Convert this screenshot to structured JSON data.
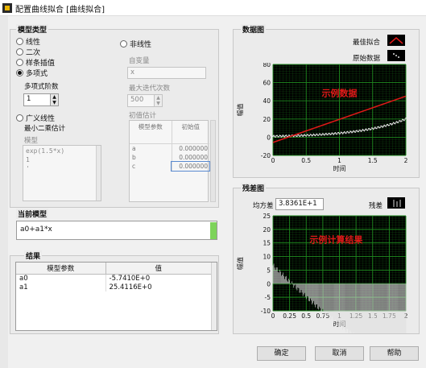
{
  "window": {
    "title": "配置曲线拟合 [曲线拟合]"
  },
  "model_type": {
    "label": "模型类型",
    "options": [
      "线性",
      "二次",
      "样条插值",
      "多项式"
    ],
    "selected": "多项式",
    "poly_order_label": "多项式阶数",
    "poly_order_value": "1",
    "general_ls_label": "广义线性",
    "general_ls_sub": "最小二乘估计",
    "model_label": "模型",
    "model_lines": [
      "exp(1.5*x)",
      "1",
      "'"
    ],
    "nonlinear_label": "非线性",
    "indep_label": "自变量",
    "indep_value": "x",
    "max_iter_label": "最大迭代次数",
    "max_iter_value": "500",
    "init_est_label": "初值估计",
    "init_headers": [
      "模型参数",
      "初始值"
    ],
    "init_rows": [
      [
        "a",
        "0.000000"
      ],
      [
        "b",
        "0.000000"
      ],
      [
        "c",
        "0.000000"
      ]
    ]
  },
  "current_model": {
    "label": "当前模型",
    "value": "a0+a1*x"
  },
  "results": {
    "label": "结果",
    "headers": [
      "模型参数",
      "值"
    ],
    "rows": [
      [
        "a0",
        "-5.7410E+0"
      ],
      [
        "a1",
        "25.4116E+0"
      ]
    ]
  },
  "data_graph": {
    "label": "数据图",
    "legend": [
      "最佳拟合",
      "原始数据"
    ],
    "annotation": "示例数据",
    "ylabel": "幅值",
    "xlabel": "时间",
    "colors": {
      "fit": "#e01818",
      "raw": "#e6e6e6",
      "grid": "#1f8a1f",
      "annotation": "#e01818"
    }
  },
  "residual_graph": {
    "label": "残差图",
    "mse_label": "均方差",
    "mse_value": "3.8361E+1",
    "legend": [
      "残差"
    ],
    "annotation": "示例计算结果",
    "ylabel": "幅值",
    "xlabel": "时间"
  },
  "buttons": {
    "ok": "确定",
    "cancel": "取消",
    "help": "帮助"
  },
  "chart_data": [
    {
      "type": "line",
      "title": "数据图",
      "xlabel": "时间",
      "ylabel": "幅值",
      "xlim": [
        0,
        2
      ],
      "ylim": [
        -20,
        80
      ],
      "xticks": [
        "0",
        "0.5",
        "1",
        "1.5",
        "2"
      ],
      "yticks": [
        "-20",
        "0",
        "20",
        "40",
        "60",
        "80"
      ],
      "grid": true,
      "legend_position": "top-right",
      "series": [
        {
          "name": "最佳拟合",
          "x": [
            0,
            2
          ],
          "y": [
            -5.741,
            45.082
          ]
        },
        {
          "name": "原始数据",
          "x": [
            0,
            0.25,
            0.5,
            0.75,
            1,
            1.25,
            1.5,
            1.75,
            2
          ],
          "y": [
            1,
            1.5,
            2.1,
            3.1,
            4.5,
            6.5,
            9.5,
            13.8,
            20.1
          ]
        }
      ]
    },
    {
      "type": "bar",
      "title": "残差图",
      "xlabel": "时间",
      "ylabel": "幅值",
      "xlim": [
        0,
        2
      ],
      "ylim": [
        -10,
        25
      ],
      "xticks": [
        "0",
        "0.25",
        "0.5",
        "0.75",
        "1",
        "1.25",
        "1.5",
        "1.75",
        "2"
      ],
      "yticks": [
        "-10",
        "-5",
        "0",
        "5",
        "10",
        "15",
        "20",
        "25"
      ],
      "grid": true,
      "legend_position": "top-right",
      "series": [
        {
          "name": "残差",
          "x": [
            0,
            0.25,
            0.5,
            0.75,
            1,
            1.25,
            1.5,
            1.75,
            2
          ],
          "y": [
            6.7,
            1.4,
            -3.4,
            -5.7,
            -7.7,
            -8.9,
            -9.3,
            -8.5,
            -5.4
          ]
        }
      ]
    }
  ]
}
